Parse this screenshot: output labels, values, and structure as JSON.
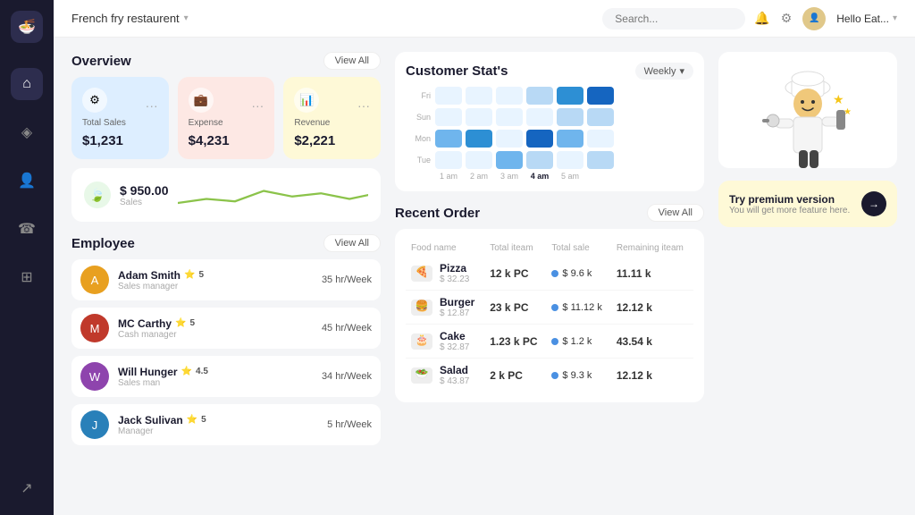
{
  "sidebar": {
    "logo_icon": "🍜",
    "items": [
      {
        "name": "home",
        "icon": "⌂",
        "active": true
      },
      {
        "name": "navigation",
        "icon": "◈",
        "active": false
      },
      {
        "name": "users",
        "icon": "👤",
        "active": false
      },
      {
        "name": "chat",
        "icon": "☎",
        "active": false
      },
      {
        "name": "grid",
        "icon": "⊞",
        "active": false
      },
      {
        "name": "export",
        "icon": "↗",
        "active": false
      }
    ]
  },
  "header": {
    "brand": "French fry restaurent",
    "search_placeholder": "Search...",
    "user_name": "Hello Eat...",
    "bell_icon": "🔔",
    "gear_icon": "⚙"
  },
  "overview": {
    "title": "Overview",
    "view_all": "View All",
    "cards": [
      {
        "label": "Total Sales",
        "value": "$1,231",
        "color": "blue",
        "icon": "⚙"
      },
      {
        "label": "Expense",
        "value": "$4,231",
        "color": "pink",
        "icon": "💼"
      },
      {
        "label": "Revenue",
        "value": "$2,221",
        "color": "yellow",
        "icon": "📊"
      }
    ],
    "sales": {
      "value": "$ 950.00",
      "label": "Sales",
      "icon": "🍃"
    }
  },
  "customer_stats": {
    "title": "Customer Stat's",
    "filter": "Weekly",
    "rows": [
      {
        "label": "Fri",
        "cells": [
          0,
          0,
          0,
          1,
          2,
          3
        ]
      },
      {
        "label": "Sun",
        "cells": [
          0,
          0,
          0,
          0,
          1,
          1
        ]
      },
      {
        "label": "Mon",
        "cells": [
          1,
          2,
          0,
          3,
          1,
          0
        ]
      },
      {
        "label": "Tue",
        "cells": [
          0,
          0,
          2,
          1,
          0,
          1
        ]
      }
    ],
    "times": [
      "1 am",
      "2 am",
      "3 am",
      "4 am",
      "5 am"
    ]
  },
  "employee": {
    "title": "Employee",
    "view_all": "View All",
    "items": [
      {
        "name": "Adam Smith",
        "role": "Sales manager",
        "rating": 5,
        "hours": "35 hr/Week",
        "color": "#e8a020"
      },
      {
        "name": "MC Carthy",
        "role": "Cash manager",
        "rating": 5,
        "hours": "45 hr/Week",
        "color": "#c0392b"
      },
      {
        "name": "Will Hunger",
        "role": "Sales man",
        "rating": 4.5,
        "hours": "34 hr/Week",
        "color": "#8e44ad"
      },
      {
        "name": "Jack Sulivan",
        "role": "Manager",
        "rating": 5,
        "hours": "5 hr/Week",
        "color": "#2980b9"
      }
    ]
  },
  "recent_order": {
    "title": "Recent Order",
    "view_all": "View All",
    "columns": [
      "Food name",
      "Total iteam",
      "Total sale",
      "Remaining iteam"
    ],
    "rows": [
      {
        "icon": "🍕",
        "name": "Pizza",
        "price": "$ 32.23",
        "total_items": "12 k PC",
        "total_sale": "$ 9.6 k",
        "remaining": "11.11 k"
      },
      {
        "icon": "🍔",
        "name": "Burger",
        "price": "$ 12.87",
        "total_items": "23 k PC",
        "total_sale": "$ 11.12 k",
        "remaining": "12.12 k"
      },
      {
        "icon": "🎂",
        "name": "Cake",
        "price": "$ 32.87",
        "total_items": "1.23 k PC",
        "total_sale": "$ 1.2 k",
        "remaining": "43.54 k"
      },
      {
        "icon": "🥗",
        "name": "Salad",
        "price": "$ 43.87",
        "total_items": "2 k PC",
        "total_sale": "$ 9.3 k",
        "remaining": "12.12 k"
      }
    ]
  },
  "premium": {
    "title": "Try premium version",
    "subtitle": "You will get more feature here.",
    "btn_icon": "→"
  }
}
